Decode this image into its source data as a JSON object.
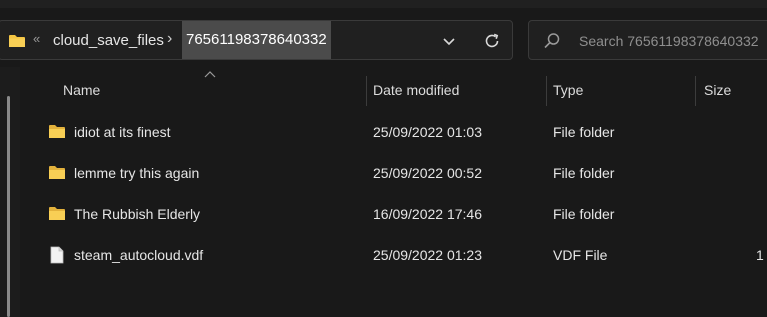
{
  "address_bar": {
    "overflow_glyph": "«",
    "crumbs": [
      {
        "label": "cloud_save_files"
      },
      {
        "label": "76561198378640332"
      }
    ],
    "separator": "›"
  },
  "search": {
    "placeholder": "Search 76561198378640332"
  },
  "columns": [
    {
      "label": "Name"
    },
    {
      "label": "Date modified"
    },
    {
      "label": "Type"
    },
    {
      "label": "Size"
    }
  ],
  "rows": [
    {
      "icon": "folder-icon",
      "name": "idiot at its finest",
      "date": "25/09/2022 01:03",
      "type": "File folder",
      "size": ""
    },
    {
      "icon": "folder-icon",
      "name": "lemme try this again",
      "date": "25/09/2022 00:52",
      "type": "File folder",
      "size": ""
    },
    {
      "icon": "folder-icon",
      "name": "The Rubbish Elderly",
      "date": "16/09/2022 17:46",
      "type": "File folder",
      "size": ""
    },
    {
      "icon": "file-icon",
      "name": "steam_autocloud.vdf",
      "date": "25/09/2022 01:23",
      "type": "VDF File",
      "size": "1"
    }
  ],
  "colors": {
    "background": "#191919",
    "folder": "#f4c542",
    "selected_crumb": "#4b4b4b"
  }
}
